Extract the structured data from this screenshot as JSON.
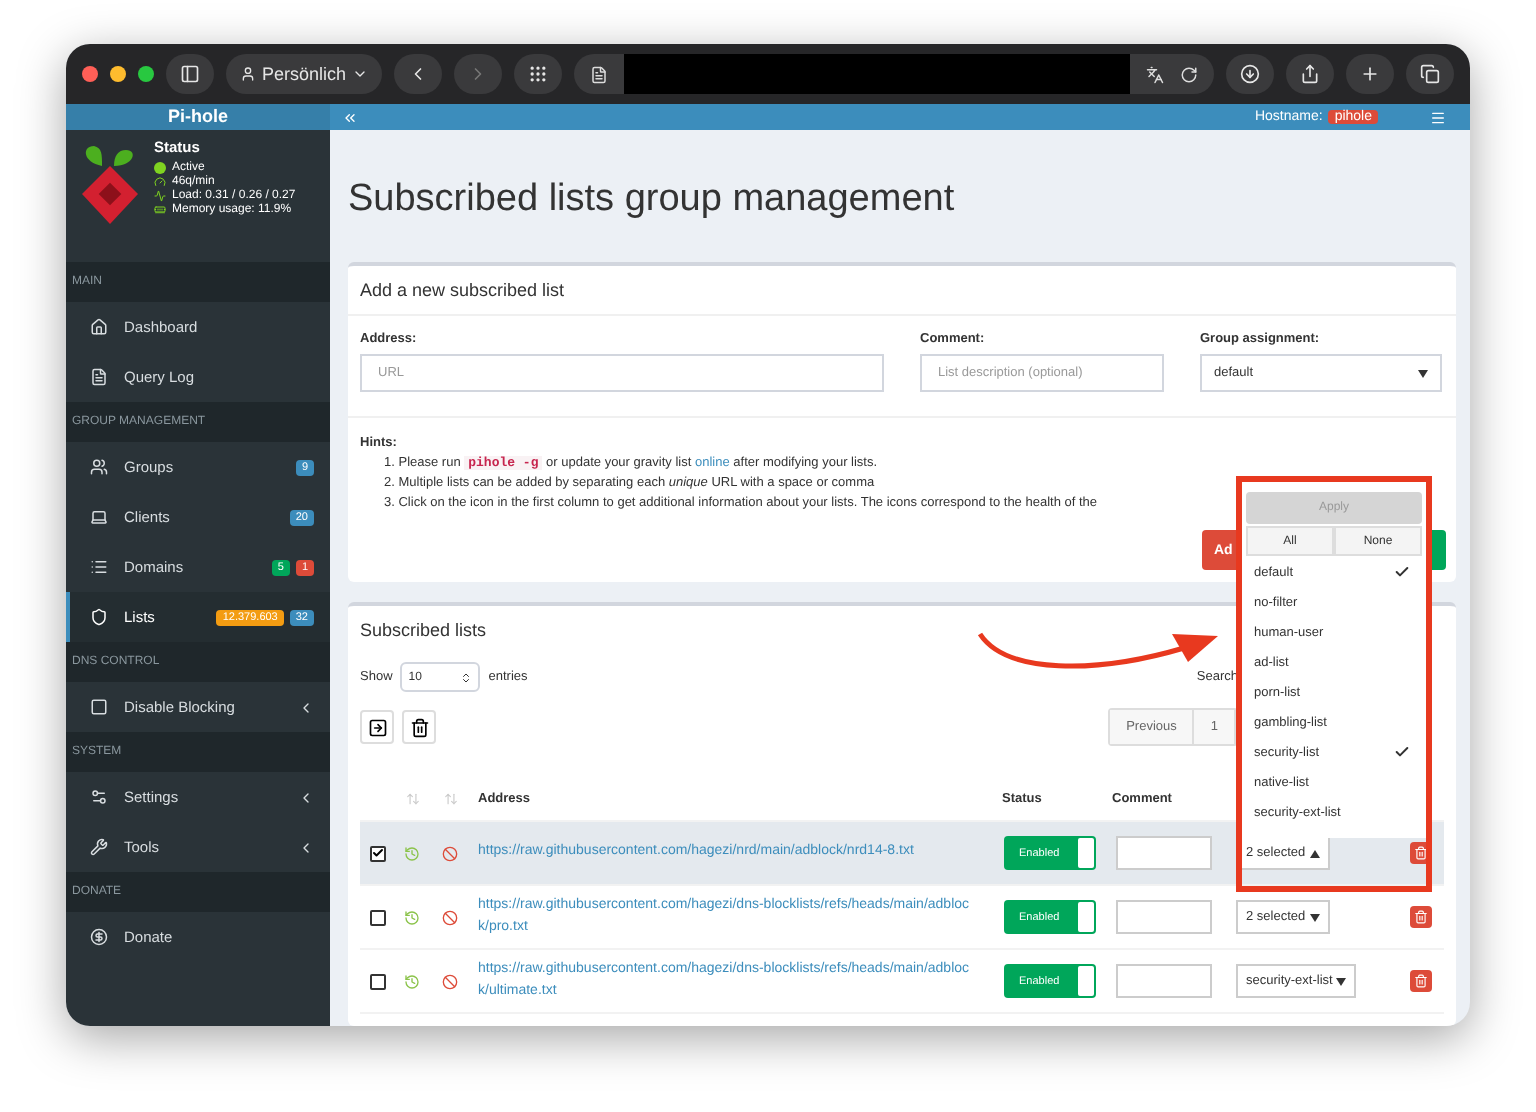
{
  "browser": {
    "profile": "Persönlich"
  },
  "header": {
    "brand": "Pi-hole",
    "hostname_label": "Hostname:",
    "hostname": "pihole"
  },
  "sidebar": {
    "status": {
      "title": "Status",
      "items": [
        {
          "kind": "dot",
          "text": "Active"
        },
        {
          "kind": "gauge",
          "text": "46q/min"
        },
        {
          "kind": "load",
          "text": "Load: 0.31 / 0.26 / 0.27"
        },
        {
          "kind": "memory",
          "text": "Memory usage: 11.9%"
        }
      ]
    },
    "sections": [
      {
        "title": "MAIN",
        "items": [
          {
            "kind": "home",
            "label": "Dashboard",
            "selected": false,
            "submenu": false
          },
          {
            "kind": "file",
            "label": "Query Log",
            "selected": false,
            "submenu": false
          }
        ]
      },
      {
        "title": "GROUP MANAGEMENT",
        "items": [
          {
            "kind": "users",
            "label": "Groups",
            "selected": false,
            "submenu": false,
            "badges": [
              {
                "text": "9",
                "color": "#3c8dbc"
              }
            ]
          },
          {
            "kind": "laptop",
            "label": "Clients",
            "selected": false,
            "submenu": false,
            "badges": [
              {
                "text": "20",
                "color": "#3c8dbc"
              }
            ]
          },
          {
            "kind": "list",
            "label": "Domains",
            "selected": false,
            "submenu": false,
            "badges": [
              {
                "text": "5",
                "color": "#00a65a"
              },
              {
                "text": "1",
                "color": "#dd4b39"
              }
            ]
          },
          {
            "kind": "shield",
            "label": "Lists",
            "selected": true,
            "submenu": false,
            "badges": [
              {
                "text": "12.379.603",
                "color": "#f39c12"
              },
              {
                "text": "32",
                "color": "#3c8dbc"
              }
            ]
          }
        ]
      },
      {
        "title": "DNS CONTROL",
        "items": [
          {
            "kind": "stop",
            "label": "Disable Blocking",
            "selected": false,
            "submenu": true
          }
        ]
      },
      {
        "title": "SYSTEM",
        "items": [
          {
            "kind": "cogs",
            "label": "Settings",
            "selected": false,
            "submenu": true
          },
          {
            "kind": "tools",
            "label": "Tools",
            "selected": false,
            "submenu": true
          }
        ]
      },
      {
        "title": "DONATE",
        "items": [
          {
            "kind": "donate",
            "label": "Donate",
            "selected": false,
            "submenu": false
          }
        ]
      }
    ]
  },
  "page_title": "Subscribed lists group management",
  "add_card": {
    "title": "Add a new subscribed list",
    "address": {
      "label": "Address:",
      "placeholder": "URL"
    },
    "comment": {
      "label": "Comment:",
      "placeholder": "List description (optional)"
    },
    "group": {
      "label": "Group assignment:",
      "value": "default"
    },
    "hints_title": "Hints:",
    "hints": [
      {
        "number": "1.",
        "before": "Please run",
        "code": "pihole -g",
        "middle": "or update your gravity list",
        "link": "online",
        "after": "after modifying your lists."
      },
      {
        "number": "2.",
        "text": "Multiple lists can be added by separating each *unique* URL with a space or comma"
      },
      {
        "number": "3.",
        "text": "Click on the icon in the first column to get additional information about your lists. The icons correspond to the health of the"
      }
    ],
    "add_button": "Ad"
  },
  "lists_card": {
    "title": "Subscribed lists",
    "show_label": "Show",
    "page_size": "10",
    "entries_label": "entries",
    "search_label": "Search",
    "previous": "Previous",
    "page": "1",
    "columns": [
      "Address",
      "Status",
      "Comment"
    ],
    "rows": [
      {
        "checked": true,
        "selected": true,
        "address": "https://raw.githubusercontent.com/hagezi/nrd/main/adblock/nrd14-8.txt",
        "enabled": true,
        "status": "Enabled",
        "group": "2 selected",
        "open": true
      },
      {
        "checked": false,
        "selected": false,
        "address": "https://raw.githubusercontent.com/hagezi/dns-blocklists/refs/heads/main/adblock/pro.txt",
        "enabled": true,
        "status": "Enabled",
        "group": "2 selected",
        "open": false
      },
      {
        "checked": false,
        "selected": false,
        "address": "https://raw.githubusercontent.com/hagezi/dns-blocklists/refs/heads/main/adblock/ultimate.txt",
        "enabled": true,
        "status": "Enabled",
        "group": "security-ext-list",
        "open": false
      }
    ]
  },
  "group_menu": {
    "apply": "Apply",
    "apply_disabled": true,
    "all": "All",
    "none": "None",
    "options": [
      {
        "label": "default",
        "selected": true
      },
      {
        "label": "no-filter",
        "selected": false
      },
      {
        "label": "human-user",
        "selected": false
      },
      {
        "label": "ad-list",
        "selected": false
      },
      {
        "label": "porn-list",
        "selected": false
      },
      {
        "label": "gambling-list",
        "selected": false
      },
      {
        "label": "security-list",
        "selected": true
      },
      {
        "label": "native-list",
        "selected": false
      },
      {
        "label": "security-ext-list",
        "selected": false
      }
    ]
  }
}
